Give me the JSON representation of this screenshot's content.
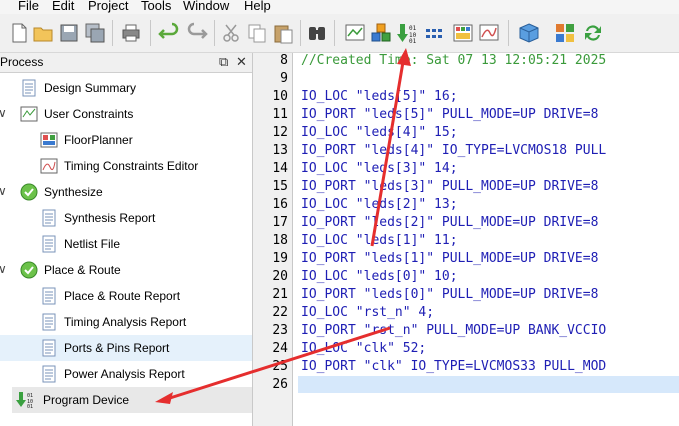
{
  "menu": [
    "File",
    "Edit",
    "Project",
    "Tools",
    "Window",
    "Help"
  ],
  "toolbar": {
    "icons": [
      "new-file-icon",
      "open-folder-icon",
      "save-icon",
      "save-all-icon",
      "print-icon",
      "undo-icon",
      "redo-icon",
      "cut-icon",
      "copy-icon",
      "paste-icon",
      "find-icon",
      "schematic-icon",
      "synthesize-icon",
      "program-device-icon",
      "pinout-icon",
      "report-icon",
      "timing-icon",
      "package-icon",
      "floorplan-icon",
      "refresh-icon"
    ]
  },
  "process": {
    "title": "Process",
    "items": [
      {
        "label": "Design Summary",
        "icon": "document-icon",
        "indent": 1
      },
      {
        "label": "User Constraints",
        "icon": "constraints-icon",
        "indent": 0,
        "expanded": true
      },
      {
        "label": "FloorPlanner",
        "icon": "floorplanner-icon",
        "indent": 2
      },
      {
        "label": "Timing Constraints Editor",
        "icon": "timing-editor-icon",
        "indent": 2
      },
      {
        "label": "Synthesize",
        "icon": "check-icon",
        "indent": 0,
        "expanded": true
      },
      {
        "label": "Synthesis Report",
        "icon": "document-icon",
        "indent": 2
      },
      {
        "label": "Netlist File",
        "icon": "document-icon",
        "indent": 2
      },
      {
        "label": "Place & Route",
        "icon": "check-icon",
        "indent": 0,
        "expanded": true
      },
      {
        "label": "Place & Route Report",
        "icon": "document-icon",
        "indent": 2
      },
      {
        "label": "Timing Analysis Report",
        "icon": "document-icon",
        "indent": 2
      },
      {
        "label": "Ports & Pins Report",
        "icon": "document-icon",
        "indent": 2,
        "selected": true
      },
      {
        "label": "Power Analysis Report",
        "icon": "document-icon",
        "indent": 2
      },
      {
        "label": "Program Device",
        "icon": "program-device-icon",
        "indent": 1,
        "highlighted": true
      }
    ]
  },
  "editor": {
    "lines": [
      {
        "n": "8",
        "text": "//Created Time: Sat 07 13 12:05:21 2025",
        "comment": true
      },
      {
        "n": "9",
        "text": ""
      },
      {
        "n": "10",
        "text": "IO_LOC \"leds[5]\" 16;"
      },
      {
        "n": "11",
        "text": "IO_PORT \"leds[5]\" PULL_MODE=UP DRIVE=8"
      },
      {
        "n": "12",
        "text": "IO_LOC \"leds[4]\" 15;"
      },
      {
        "n": "13",
        "text": "IO_PORT \"leds[4]\" IO_TYPE=LVCMOS18 PULL"
      },
      {
        "n": "14",
        "text": "IO_LOC \"leds[3]\" 14;"
      },
      {
        "n": "15",
        "text": "IO_PORT \"leds[3]\" PULL_MODE=UP DRIVE=8"
      },
      {
        "n": "16",
        "text": "IO_LOC \"leds[2]\" 13;"
      },
      {
        "n": "17",
        "text": "IO_PORT \"leds[2]\" PULL_MODE=UP DRIVE=8"
      },
      {
        "n": "18",
        "text": "IO_LOC \"leds[1]\" 11;"
      },
      {
        "n": "19",
        "text": "IO_PORT \"leds[1]\" PULL_MODE=UP DRIVE=8"
      },
      {
        "n": "20",
        "text": "IO_LOC \"leds[0]\" 10;"
      },
      {
        "n": "21",
        "text": "IO_PORT \"leds[0]\" PULL_MODE=UP DRIVE=8"
      },
      {
        "n": "22",
        "text": "IO_LOC \"rst_n\" 4;"
      },
      {
        "n": "23",
        "text": "IO_PORT \"rst_n\" PULL_MODE=UP BANK_VCCIO"
      },
      {
        "n": "24",
        "text": "IO_LOC \"clk\" 52;"
      },
      {
        "n": "25",
        "text": "IO_PORT \"clk\" IO_TYPE=LVCMOS33 PULL_MOD"
      },
      {
        "n": "26",
        "text": ""
      }
    ],
    "current_line": "26"
  },
  "colors": {
    "code_text": "#1e1eb4",
    "comment": "#3a9a3a",
    "selection": "#e5f1fb",
    "annotation_arrow": "#e52e2e"
  }
}
